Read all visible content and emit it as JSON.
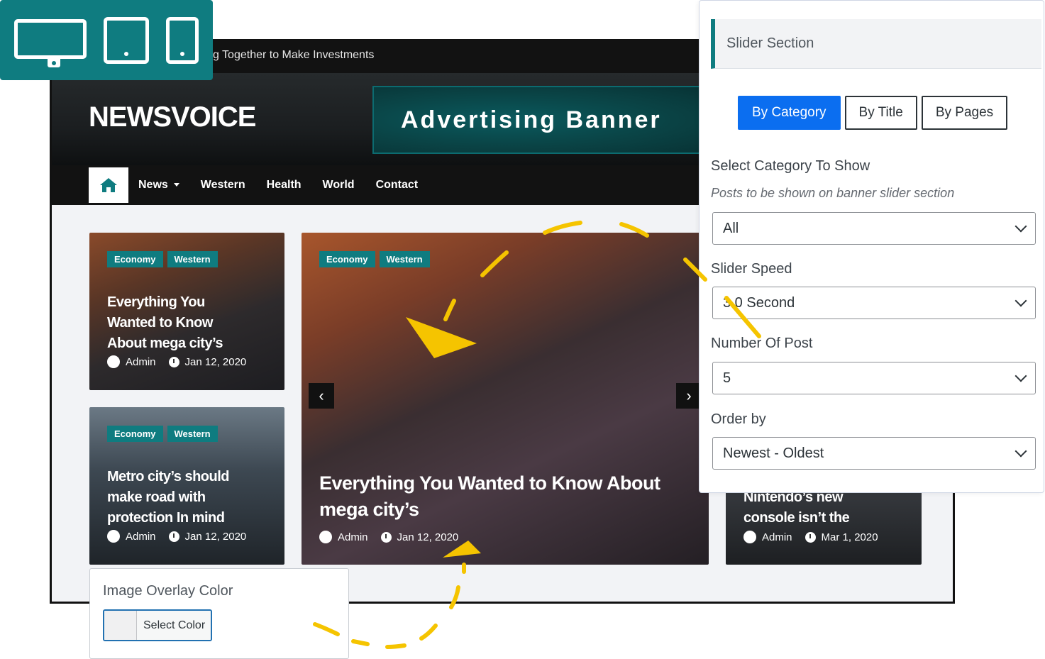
{
  "colors": {
    "accent": "#0f7c80",
    "primary_button": "#0b6ef0",
    "doodle": "#f5c400"
  },
  "device_switcher": {
    "icons": [
      "desktop-icon",
      "tablet-icon",
      "mobile-icon"
    ]
  },
  "site": {
    "ticker_text": "g Together to Make Investments",
    "logo": "NEWSVOICE",
    "ad_banner": "Advertising Banner",
    "nav": {
      "items": [
        "News",
        "Western",
        "Health",
        "World",
        "Contact"
      ]
    },
    "cards": [
      {
        "tags": [
          "Economy",
          "Western"
        ],
        "title_lines": [
          "Everything You",
          "Wanted to Know",
          "About mega city’s"
        ],
        "author": "Admin",
        "date": "Jan 12, 2020"
      },
      {
        "tags": [
          "Economy",
          "Western"
        ],
        "title_lines": [
          "Metro city’s should",
          "make road with",
          "protection In mind"
        ],
        "author": "Admin",
        "date": "Jan 12, 2020"
      },
      {
        "tags": [
          "Economy",
          "Western"
        ],
        "title_lines": [
          "Everything You Wanted to Know About",
          "mega city’s"
        ],
        "author": "Admin",
        "date": "Jan 12, 2020"
      },
      {
        "tags": [],
        "title_lines": [
          "Nintendo’s new",
          "console isn’t the"
        ],
        "author": "Admin",
        "date": "Mar 1, 2020"
      }
    ]
  },
  "panel": {
    "title": "Slider Section",
    "tabs": [
      "By Category",
      "By Title",
      "By Pages"
    ],
    "active_tab": "By Category",
    "category": {
      "label": "Select Category To Show",
      "description": "Posts to be shown on banner slider section",
      "value": "All"
    },
    "speed": {
      "label": "Slider Speed",
      "value": "3.0 Second"
    },
    "number": {
      "label": "Number Of Post",
      "value": "5"
    },
    "order": {
      "label": "Order by",
      "value": "Newest - Oldest"
    }
  },
  "overlay": {
    "label": "Image Overlay Color",
    "button": "Select Color"
  }
}
